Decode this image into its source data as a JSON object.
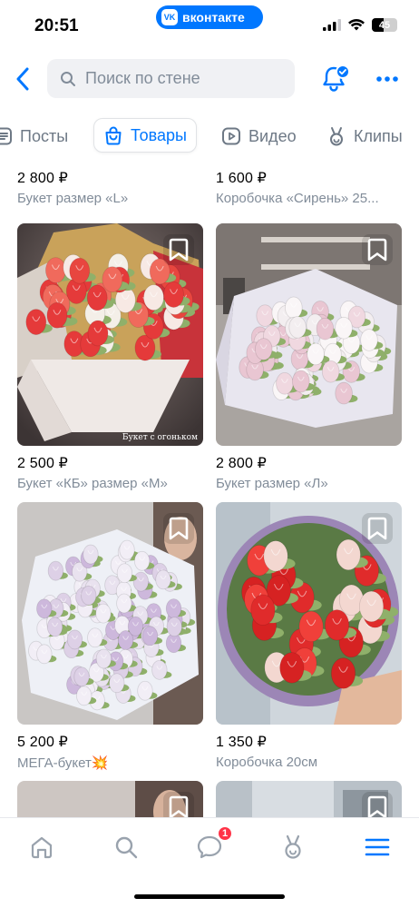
{
  "status_bar": {
    "time": "20:51",
    "app_pill": "вконтакте",
    "battery": "45",
    "battery_level": 0.45
  },
  "header": {
    "search_placeholder": "Поиск по стене"
  },
  "tabs": [
    {
      "label": "Посты",
      "active": false
    },
    {
      "label": "Товары",
      "active": true
    },
    {
      "label": "Видео",
      "active": false
    },
    {
      "label": "Клипы",
      "active": false
    }
  ],
  "products_top": [
    {
      "price": "2 800 ₽",
      "title": "Букет размер «L»"
    },
    {
      "price": "1 600 ₽",
      "title": "Коробочка «Сирень» 25..."
    }
  ],
  "products": [
    {
      "price": "2 500 ₽",
      "title": "Букет «КБ» размер «М»",
      "watermark": "Букет с огоньком"
    },
    {
      "price": "2 800 ₽",
      "title": "Букет размер «Л»"
    },
    {
      "price": "5 200 ₽",
      "title": "МЕГА-букет💥"
    },
    {
      "price": "1 350 ₽",
      "title": "Коробочка 20см"
    }
  ],
  "bottom_nav": {
    "messages_badge": "1"
  },
  "colors": {
    "accent": "#0077ff",
    "badge": "#ff3347",
    "secondary_text": "#818c99"
  }
}
